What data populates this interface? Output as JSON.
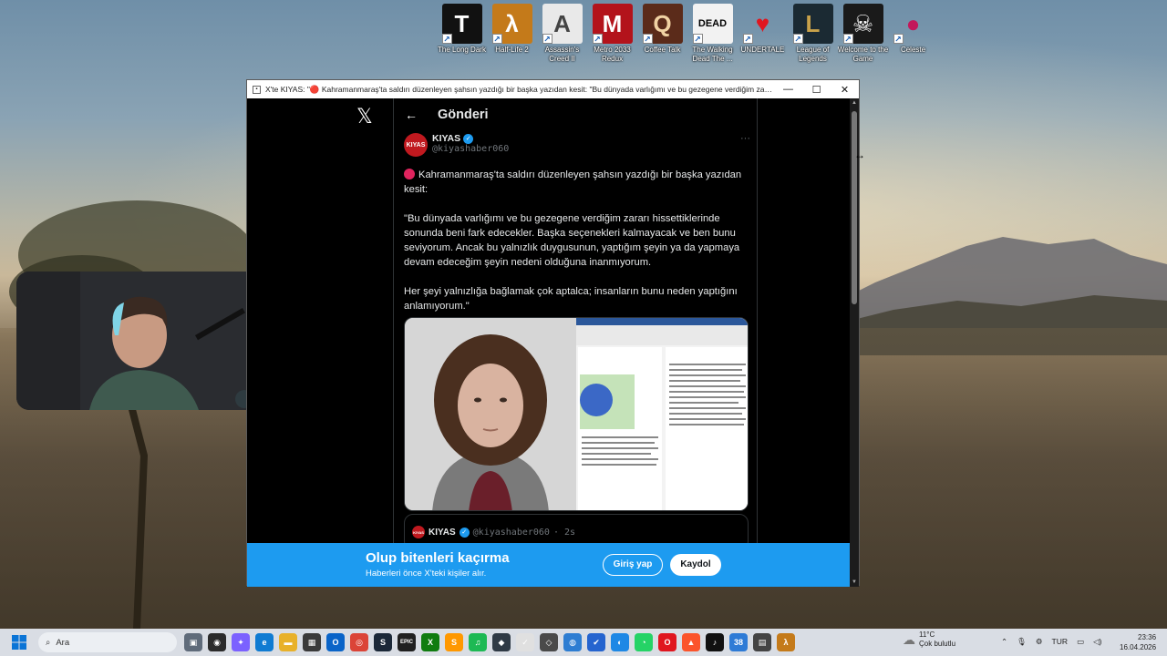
{
  "desktop": {
    "icons": [
      {
        "label": "The Long Dark",
        "glyph": "T",
        "bg": "#111111",
        "fg": "#ffffff"
      },
      {
        "label": "Half-Life 2",
        "glyph": "λ",
        "bg": "#c47a1a",
        "fg": "#ffffff"
      },
      {
        "label": "Assassin's Creed II",
        "glyph": "A",
        "bg": "#e9e9e9",
        "fg": "#444444"
      },
      {
        "label": "Metro 2033 Redux",
        "glyph": "M",
        "bg": "#b3131b",
        "fg": "#ffffff"
      },
      {
        "label": "Coffee Talk",
        "glyph": "Q",
        "bg": "#5b2b1a",
        "fg": "#f1d2a3"
      },
      {
        "label": "The Walking Dead The ...",
        "glyph": "DEAD",
        "bg": "#f2f2f2",
        "fg": "#000000"
      },
      {
        "label": "UNDERTALE",
        "glyph": "♥",
        "bg": "rgba(0,0,0,0)",
        "fg": "#e0161f"
      },
      {
        "label": "League of Legends",
        "glyph": "L",
        "bg": "#1b2a33",
        "fg": "#c9a24a"
      },
      {
        "label": "Welcome to the Game",
        "glyph": "☠",
        "bg": "#1a1a1a",
        "fg": "#ffffff"
      },
      {
        "label": "Celeste",
        "glyph": "●",
        "bg": "rgba(0,0,0,0)",
        "fg": "#c2185b"
      }
    ]
  },
  "window": {
    "title": "X'te KIYAS: \"🔴 Kahramanmaraş'ta saldırı düzenleyen şahsın yazdığı bir başka yazıdan kesit: \"Bu dünyada varlığımı ve bu gezegene verdiğim zararı hissettikler...",
    "controls": {
      "minimize": "—",
      "maximize": "☐",
      "close": "✕"
    }
  },
  "page": {
    "x_logo": "𝕏",
    "header": {
      "back": "←",
      "title": "Gönderi"
    },
    "tweet": {
      "avatar_text": "KIYAS",
      "display_name": "KIYAS",
      "handle": "@kiyashaber060",
      "more": "···",
      "paragraphs": [
        "Kahramanmaraş'ta saldırı düzenleyen şahsın yazdığı bir başka yazıdan kesit:",
        "\"Bu dünyada varlığımı ve bu gezegene verdiğim zararı hissettiklerinde sonunda beni fark edecekler. Başka seçenekleri kalmayacak ve ben bunu seviyorum. Ancak bu yalnızlık duygusunun, yaptığım şeyin ya da yapmaya devam edeceğim şeyin nedeni olduğuna inanmıyorum.",
        "Her şeyi yalnızlığa bağlamak çok aptalca; insanların bunu neden yaptığını anlamıyorum.\""
      ]
    },
    "quoted": {
      "avatar_text": "KIYAS",
      "display_name": "KIYAS",
      "handle": "@kiyashaber060",
      "time": "· 2s"
    },
    "banner": {
      "title": "Olup bitenleri kaçırma",
      "subtitle": "Haberleri önce X'teki kişiler alır.",
      "login": "Giriş yap",
      "signup": "Kaydol"
    }
  },
  "taskbar": {
    "search_placeholder": "Ara",
    "apps": [
      {
        "name": "task-view",
        "glyph": "▣",
        "bg": "#5f6b7a"
      },
      {
        "name": "obs",
        "glyph": "◉",
        "bg": "#2b2b2b"
      },
      {
        "name": "copilot",
        "glyph": "✦",
        "bg": "#7b61ff"
      },
      {
        "name": "edge",
        "glyph": "e",
        "bg": "#0f7bd2"
      },
      {
        "name": "file-explorer",
        "glyph": "▬",
        "bg": "#e8b12a"
      },
      {
        "name": "store",
        "glyph": "▦",
        "bg": "#3a3a3a"
      },
      {
        "name": "outlook",
        "glyph": "O",
        "bg": "#0a64c8"
      },
      {
        "name": "chrome",
        "glyph": "◎",
        "bg": "#db4437"
      },
      {
        "name": "steam",
        "glyph": "S",
        "bg": "#1b2838"
      },
      {
        "name": "epic",
        "glyph": "EPIC",
        "bg": "#202020"
      },
      {
        "name": "xbox",
        "glyph": "X",
        "bg": "#107c10"
      },
      {
        "name": "sublime",
        "glyph": "S",
        "bg": "#ff9800"
      },
      {
        "name": "spotify",
        "glyph": "♫",
        "bg": "#1db954"
      },
      {
        "name": "davinci",
        "glyph": "◆",
        "bg": "#2f3a45"
      },
      {
        "name": "capture",
        "glyph": "✓",
        "bg": "#e0e0e0"
      },
      {
        "name": "photos",
        "glyph": "◇",
        "bg": "#4a4a4a"
      },
      {
        "name": "globe",
        "glyph": "◍",
        "bg": "#2d7dd2"
      },
      {
        "name": "todo",
        "glyph": "✔",
        "bg": "#2564cf"
      },
      {
        "name": "shield",
        "glyph": "◐",
        "bg": "#1e88e5"
      },
      {
        "name": "whatsapp",
        "glyph": "◔",
        "bg": "#25d366"
      },
      {
        "name": "opera",
        "glyph": "O",
        "bg": "#e0161f"
      },
      {
        "name": "brave",
        "glyph": "▲",
        "bg": "#fb542b"
      },
      {
        "name": "tiktok",
        "glyph": "♪",
        "bg": "#111111"
      },
      {
        "name": "messages",
        "glyph": "38",
        "bg": "#2e7bd6"
      },
      {
        "name": "calculator",
        "glyph": "▤",
        "bg": "#444444"
      },
      {
        "name": "half-life",
        "glyph": "λ",
        "bg": "#c47a1a"
      }
    ],
    "weather_temp": "11°C",
    "weather_desc": "Çok bulutlu",
    "tray_lang": "TUR",
    "time": "23:36",
    "date": "16.04.2026"
  }
}
